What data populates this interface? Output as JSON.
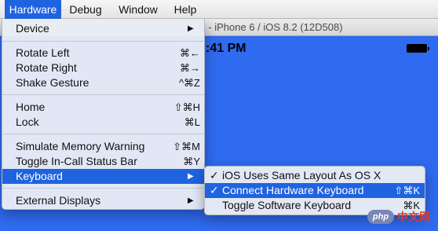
{
  "menubar": {
    "items": [
      {
        "label": "Hardware",
        "active": true
      },
      {
        "label": "Debug",
        "active": false
      },
      {
        "label": "Window",
        "active": false
      },
      {
        "label": "Help",
        "active": false
      }
    ]
  },
  "simulator": {
    "title": "S - iPhone 6 / iOS 8.2 (12D508)",
    "status_time": ":41 PM"
  },
  "hardware_menu": {
    "device": {
      "label": "Device",
      "arrow": "▶"
    },
    "rotate_left": {
      "label": "Rotate Left",
      "shortcut": "⌘←"
    },
    "rotate_right": {
      "label": "Rotate Right",
      "shortcut": "⌘→"
    },
    "shake_gesture": {
      "label": "Shake Gesture",
      "shortcut": "^⌘Z"
    },
    "home": {
      "label": "Home",
      "shortcut": "⇧⌘H"
    },
    "lock": {
      "label": "Lock",
      "shortcut": "⌘L"
    },
    "simulate_memory_warning": {
      "label": "Simulate Memory Warning",
      "shortcut": "⇧⌘M"
    },
    "toggle_in_call_status_bar": {
      "label": "Toggle In-Call Status Bar",
      "shortcut": "⌘Y"
    },
    "keyboard": {
      "label": "Keyboard",
      "arrow": "▶",
      "highlighted": true
    },
    "external_displays": {
      "label": "External Displays",
      "arrow": "▶"
    }
  },
  "keyboard_submenu": {
    "same_layout": {
      "check": "✓",
      "label": "iOS Uses Same Layout As OS X",
      "shortcut": ""
    },
    "connect_hardware": {
      "check": "✓",
      "label": "Connect Hardware Keyboard",
      "shortcut": "⇧⌘K",
      "highlighted": true
    },
    "toggle_software": {
      "check": "",
      "label": "Toggle Software Keyboard",
      "shortcut": "⌘K"
    }
  },
  "watermark": {
    "logo": "php",
    "text": "中文网"
  },
  "colors": {
    "highlight": "#1f63e0",
    "screen_blue": "#2f6bf0"
  }
}
